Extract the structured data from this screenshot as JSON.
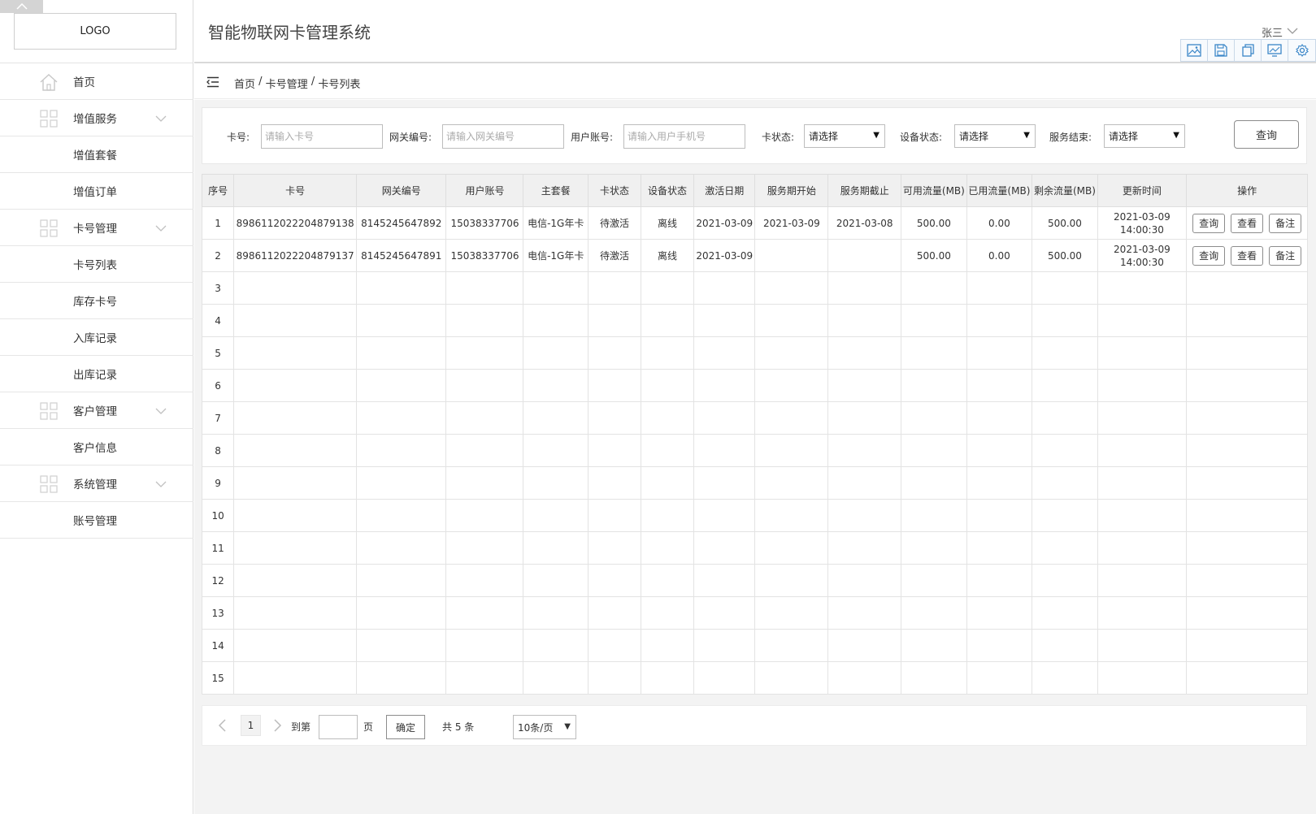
{
  "app": {
    "logo": "LOGO",
    "title": "智能物联网卡管理系统",
    "user": "张三"
  },
  "sidebar": {
    "items": [
      {
        "label": "首页"
      },
      {
        "label": "增值服务"
      },
      {
        "label": "增值套餐"
      },
      {
        "label": "增值订单"
      },
      {
        "label": "卡号管理"
      },
      {
        "label": "卡号列表"
      },
      {
        "label": "库存卡号"
      },
      {
        "label": "入库记录"
      },
      {
        "label": "出库记录"
      },
      {
        "label": "客户管理"
      },
      {
        "label": "客户信息"
      },
      {
        "label": "系统管理"
      },
      {
        "label": "账号管理"
      }
    ]
  },
  "toolbar": {
    "icons": [
      "image-icon",
      "save-icon",
      "copy-icon",
      "screen-icon",
      "gear-icon"
    ]
  },
  "breadcrumb": {
    "home": "首页",
    "sep": " / ",
    "section": "卡号管理",
    "current": "卡号列表"
  },
  "filters": {
    "card_label": "卡号:",
    "card_placeholder": "请输入卡号",
    "gateway_label": "网关编号:",
    "gateway_placeholder": "请输入网关编号",
    "user_label": "用户账号:",
    "user_placeholder": "请输入用户手机号",
    "card_status_label": "卡状态:",
    "card_status_value": "请选择",
    "device_status_label": "设备状态:",
    "device_status_value": "请选择",
    "service_end_label": "服务结束:",
    "service_end_value": "请选择",
    "query_button": "查询"
  },
  "table": {
    "headers": [
      "序号",
      "卡号",
      "网关编号",
      "用户账号",
      "主套餐",
      "卡状态",
      "设备状态",
      "激活日期",
      "服务期开始",
      "服务期截止",
      "可用流量(MB)",
      "已用流量(MB)",
      "剩余流量(MB)",
      "更新时间",
      "操作"
    ],
    "rows": [
      {
        "cells": [
          "1",
          "8986112022204879138",
          "8145245647892",
          "15038337706",
          "电信-1G年卡",
          "待激活",
          "离线",
          "2021-03-09",
          "2021-03-09",
          "2021-03-08",
          "500.00",
          "0.00",
          "500.00"
        ],
        "update_date": "2021-03-09",
        "update_time": "14:00:30"
      },
      {
        "cells": [
          "2",
          "8986112022204879137",
          "8145245647891",
          "15038337706",
          "电信-1G年卡",
          "待激活",
          "离线",
          "2021-03-09",
          "",
          "",
          "500.00",
          "0.00",
          "500.00"
        ],
        "update_date": "2021-03-09",
        "update_time": "14:00:30"
      },
      {
        "cells": [
          "3"
        ]
      },
      {
        "cells": [
          "4"
        ]
      },
      {
        "cells": [
          "5"
        ]
      },
      {
        "cells": [
          "6"
        ]
      },
      {
        "cells": [
          "7"
        ]
      },
      {
        "cells": [
          "8"
        ]
      },
      {
        "cells": [
          "9"
        ]
      },
      {
        "cells": [
          "10"
        ]
      },
      {
        "cells": [
          "11"
        ]
      },
      {
        "cells": [
          "12"
        ]
      },
      {
        "cells": [
          "13"
        ]
      },
      {
        "cells": [
          "14"
        ]
      },
      {
        "cells": [
          "15"
        ]
      }
    ],
    "actions": [
      "查询",
      "查看",
      "备注"
    ]
  },
  "pagination": {
    "current_page": "1",
    "goto_label": "到第",
    "page_label": "页",
    "confirm_button": "确定",
    "total": "共 5 条",
    "page_size": "10条/页"
  },
  "colors": {
    "icon_blue": "#3a86c8",
    "header_bg": "#f0f0f0",
    "content_bg": "#f3f3f3"
  }
}
